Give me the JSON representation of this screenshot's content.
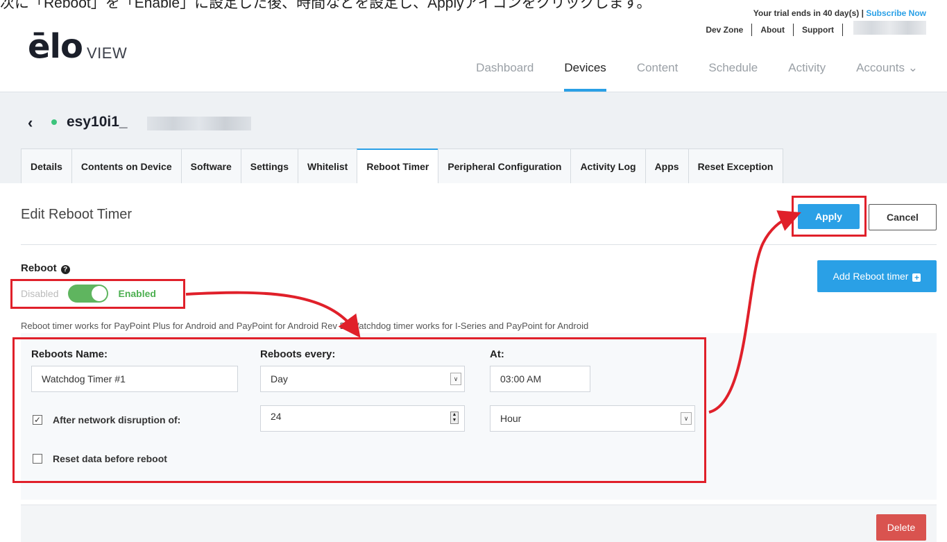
{
  "caption": "次に「Reboot」を「Enable」に設定した後、時間などを設定し、Applyアイコンをクリックします。",
  "header": {
    "trial_text": "Your trial ends in 40 day(s) |",
    "subscribe_link": "Subscribe Now",
    "top_links": [
      "Dev Zone",
      "About",
      "Support"
    ],
    "logo_main": "ēlo",
    "logo_sub": "VIEW"
  },
  "main_nav": [
    {
      "label": "Dashboard",
      "active": false
    },
    {
      "label": "Devices",
      "active": true
    },
    {
      "label": "Content",
      "active": false
    },
    {
      "label": "Schedule",
      "active": false
    },
    {
      "label": "Activity",
      "active": false
    },
    {
      "label": "Accounts ⌄",
      "active": false
    }
  ],
  "device": {
    "back_icon": "‹",
    "name": "esy10i1_"
  },
  "tabs": [
    {
      "label": "Details",
      "active": false
    },
    {
      "label": "Contents on Device",
      "active": false
    },
    {
      "label": "Software",
      "active": false
    },
    {
      "label": "Settings",
      "active": false
    },
    {
      "label": "Whitelist",
      "active": false
    },
    {
      "label": "Reboot Timer",
      "active": true
    },
    {
      "label": "Peripheral Configuration",
      "active": false
    },
    {
      "label": "Activity Log",
      "active": false
    },
    {
      "label": "Apps",
      "active": false
    },
    {
      "label": "Reset Exception",
      "active": false
    }
  ],
  "edit": {
    "title": "Edit Reboot Timer",
    "apply_label": "Apply",
    "cancel_label": "Cancel",
    "add_timer_label": "Add Reboot timer",
    "reboot_label": "Reboot",
    "toggle_disabled": "Disabled",
    "toggle_enabled": "Enabled",
    "toggle_on": true,
    "info": "Reboot timer works for PayPoint Plus for Android and PayPoint for Android Rev B, Watchdog timer works for I-Series and PayPoint for Android"
  },
  "form": {
    "name_label": "Reboots Name:",
    "name_value": "Watchdog Timer #1",
    "every_label": "Reboots every:",
    "every_value": "Day",
    "at_label": "At:",
    "at_value": "03:00 AM",
    "network_checked": true,
    "network_label": "After network disruption of:",
    "network_value": "24",
    "network_unit": "Hour",
    "reset_checked": false,
    "reset_label": "Reset data before reboot"
  },
  "delete_label": "Delete",
  "colors": {
    "accent": "#2aa0e6",
    "toggle_on": "#5fb55f",
    "delete": "#d9534f",
    "annotation": "#e0202a"
  }
}
